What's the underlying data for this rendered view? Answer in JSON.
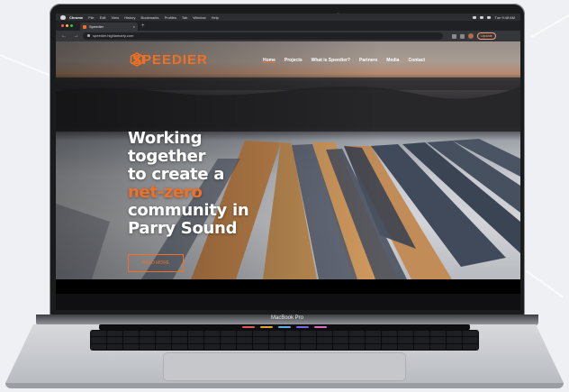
{
  "menubar": {
    "app_name": "Chrome",
    "items": [
      "File",
      "Edit",
      "View",
      "History",
      "Bookmarks",
      "Profiles",
      "Tab",
      "Window",
      "Help"
    ],
    "clock": "Tue 9:48 AM"
  },
  "browser": {
    "tab_title": "Speedier",
    "tab_close": "×",
    "new_tab": "+",
    "nav_buttons": "← → ↻",
    "url": "speedier.highlamarty.com",
    "update_label": "Update"
  },
  "site": {
    "brand": "SPEEDIER",
    "brand_color": "#f36f21",
    "nav": [
      "Home",
      "Projects",
      "What is Speedier?",
      "Partners",
      "Media",
      "Contact"
    ],
    "headline_lines": [
      "Working",
      "together",
      "to create a"
    ],
    "headline_highlight": "net-zero",
    "headline_end_lines": [
      "community in",
      "Parry Sound"
    ],
    "cta_label": "READ MORE"
  },
  "laptop": {
    "model_label": "MacBook Pro"
  }
}
